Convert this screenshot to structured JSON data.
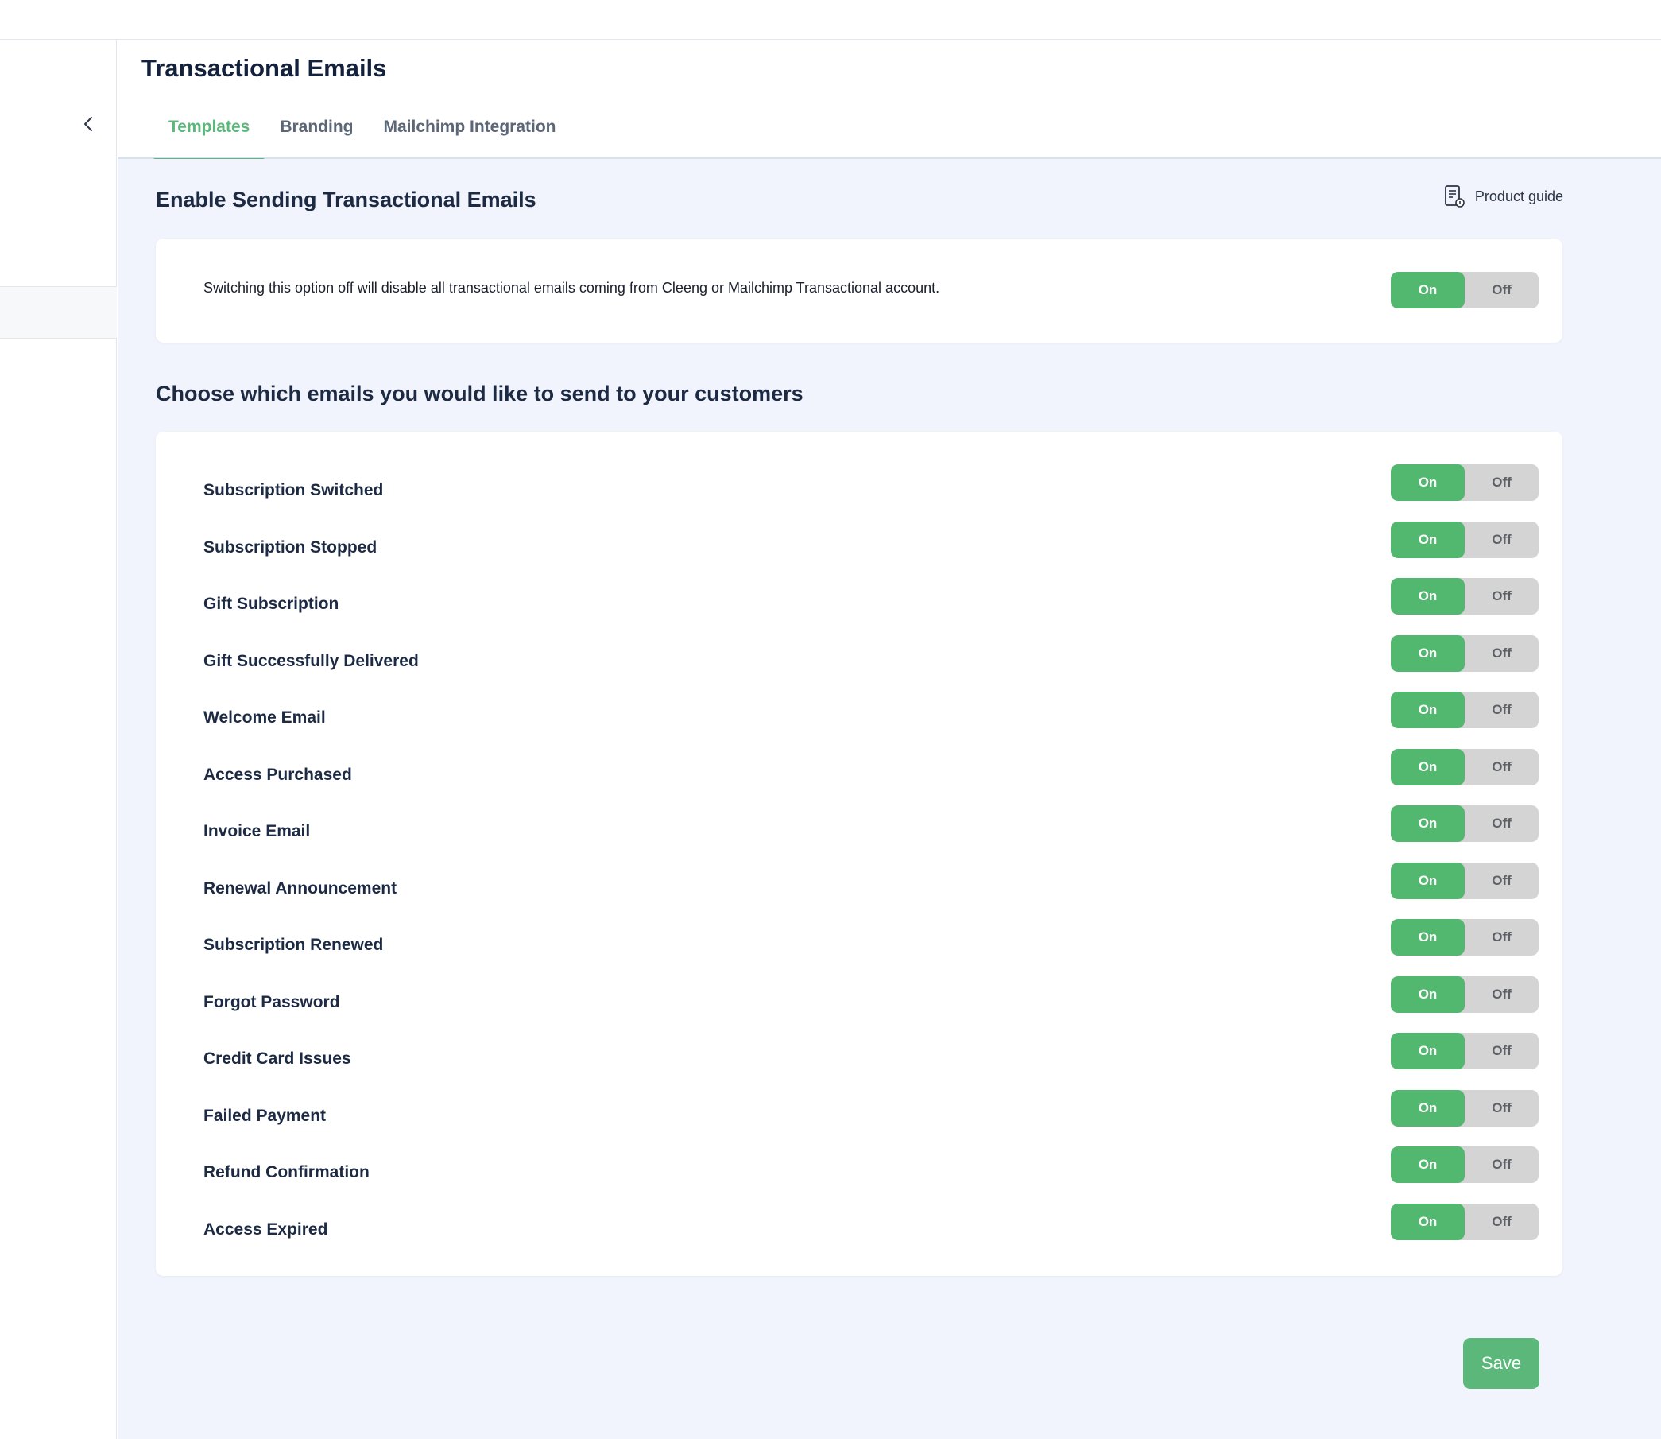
{
  "header": {
    "title": "Transactional Emails",
    "tabs": [
      {
        "label": "Templates",
        "active": true
      },
      {
        "label": "Branding",
        "active": false
      },
      {
        "label": "Mailchimp Integration",
        "active": false
      }
    ]
  },
  "sidebar": {
    "collapse_icon": "chevron-left-icon"
  },
  "enable_section": {
    "title": "Enable Sending Transactional Emails",
    "product_guide_label": "Product guide",
    "product_guide_icon": "guide-document-icon",
    "description": "Switching this option off will disable all transactional emails coming from Cleeng or Mailchimp Transactional account.",
    "toggle": {
      "on_label": "On",
      "off_label": "Off",
      "value": "On"
    }
  },
  "emails_section": {
    "title": "Choose which emails you would like to send to your customers",
    "on_label": "On",
    "off_label": "Off",
    "items": [
      {
        "label": "Subscription Switched",
        "value": "On"
      },
      {
        "label": "Subscription Stopped",
        "value": "On"
      },
      {
        "label": "Gift Subscription",
        "value": "On"
      },
      {
        "label": "Gift Successfully Delivered",
        "value": "On"
      },
      {
        "label": "Welcome Email",
        "value": "On"
      },
      {
        "label": "Access Purchased",
        "value": "On"
      },
      {
        "label": "Invoice Email",
        "value": "On"
      },
      {
        "label": "Renewal Announcement",
        "value": "On"
      },
      {
        "label": "Subscription Renewed",
        "value": "On"
      },
      {
        "label": "Forgot Password",
        "value": "On"
      },
      {
        "label": "Credit Card Issues",
        "value": "On"
      },
      {
        "label": "Failed Payment",
        "value": "On"
      },
      {
        "label": "Refund Confirmation",
        "value": "On"
      },
      {
        "label": "Access Expired",
        "value": "On"
      }
    ]
  },
  "actions": {
    "save_label": "Save"
  },
  "colors": {
    "accent": "#5cb87a",
    "toggle_on": "#52b870",
    "toggle_off": "#d4d4d4",
    "page_background": "#f1f4fc"
  }
}
